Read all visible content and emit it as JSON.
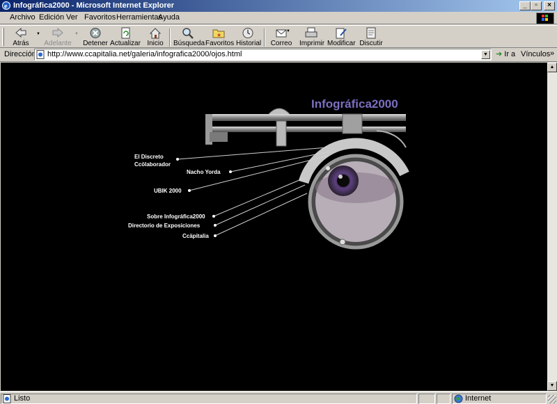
{
  "window": {
    "title": "Infográfica2000 - Microsoft Internet Explorer",
    "controls": [
      "_",
      "▫",
      "×"
    ]
  },
  "menu": [
    {
      "label": "Archivo"
    },
    {
      "label": "Edición"
    },
    {
      "label": "Ver"
    },
    {
      "label": "Favoritos"
    },
    {
      "label": "Herramientas"
    },
    {
      "label": "Ayuda"
    }
  ],
  "toolbar": {
    "back": "Atrás",
    "forward": "Adelante",
    "stop": "Detener",
    "refresh": "Actualizar",
    "home": "Inicio",
    "search": "Búsqueda",
    "favorites": "Favoritos",
    "history": "Historial",
    "mail": "Correo",
    "print": "Imprimir",
    "edit": "Modificar",
    "discuss": "Discutir"
  },
  "address": {
    "label": "Dirección",
    "url": "http://www.ccapitalia.net/galeria/infografica2000/ojos.html",
    "go": "Ir a",
    "links": "Vínculos"
  },
  "page": {
    "title": "Infográfica2000",
    "nav": {
      "discreto_1": "El Discreto",
      "discreto_2": "Ccölaborador",
      "nacho": "Nacho Yorda",
      "ubik": "UBIK 2000",
      "sobre": "Sobre Infográfica2000",
      "directorio": "Directorio de Exposiciones",
      "ccapitalia": "Ccäpitalia"
    }
  },
  "status": {
    "text": "Listo",
    "zone": "Internet"
  },
  "colors": {
    "title_accent": "#7b6fc0",
    "titlebar_start": "#0a246a",
    "titlebar_end": "#a6caf0",
    "iris": "#5a3f7a"
  }
}
